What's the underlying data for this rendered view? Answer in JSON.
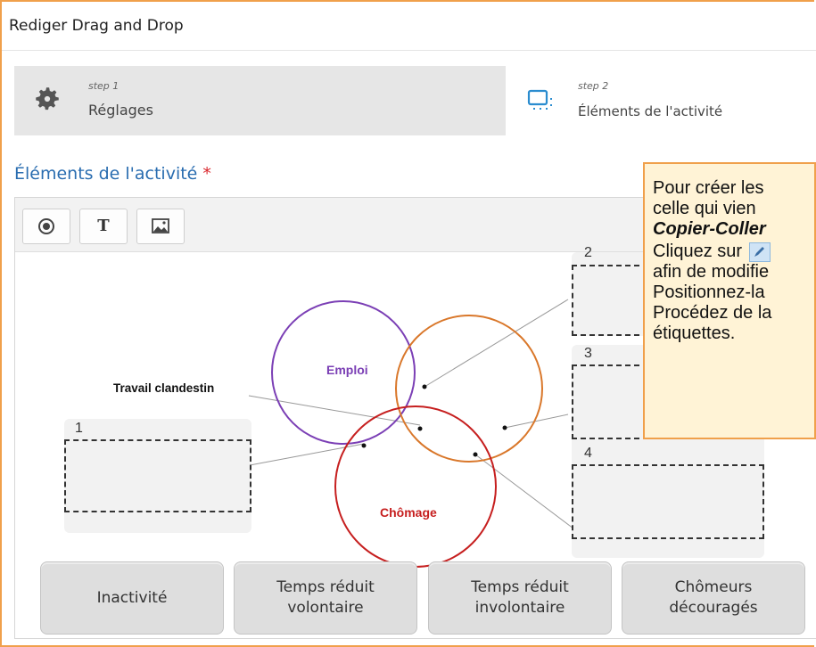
{
  "header": {
    "title": "Rediger Drag and Drop"
  },
  "steps": [
    {
      "small": "step 1",
      "label": "Réglages",
      "icon": "gear-icon"
    },
    {
      "small": "step 2",
      "label": "Éléments de l'activité",
      "icon": "element-box-icon"
    }
  ],
  "section": {
    "title": "Éléments de l'activité",
    "required_marker": "*"
  },
  "toolbar": {
    "buttons": [
      {
        "name": "target-icon"
      },
      {
        "name": "text-icon",
        "glyph": "T"
      },
      {
        "name": "image-icon"
      }
    ]
  },
  "canvas": {
    "circles": [
      {
        "label": "Emploi",
        "color": "#7b3fb5"
      },
      {
        "label": "Chômage",
        "color": "#c61f1f"
      },
      {
        "label": "",
        "color": "#d9772a"
      }
    ],
    "callout": "Travail clandestin",
    "dropzones": [
      {
        "number": "1"
      },
      {
        "number": "2"
      },
      {
        "number": "3"
      },
      {
        "number": "4"
      }
    ]
  },
  "draggables": [
    {
      "line1": "Inactivité",
      "line2": ""
    },
    {
      "line1": "Temps réduit",
      "line2": "volontaire"
    },
    {
      "line1": "Temps réduit",
      "line2": "involontaire"
    },
    {
      "line1": "Chômeurs",
      "line2": "découragés"
    }
  ],
  "tooltip": {
    "line1": "Pour créer les",
    "line2": "celle qui vien",
    "line3": "Copier-Coller",
    "line4_prefix": "Cliquez sur",
    "line5": "afin de modifie",
    "line6": "Positionnez-la",
    "line7": "Procédez de la",
    "line8": "étiquettes."
  },
  "colors": {
    "accent": "#2a6db0",
    "tooltip_border": "#f0a04b",
    "tooltip_bg": "#fff3d6"
  }
}
